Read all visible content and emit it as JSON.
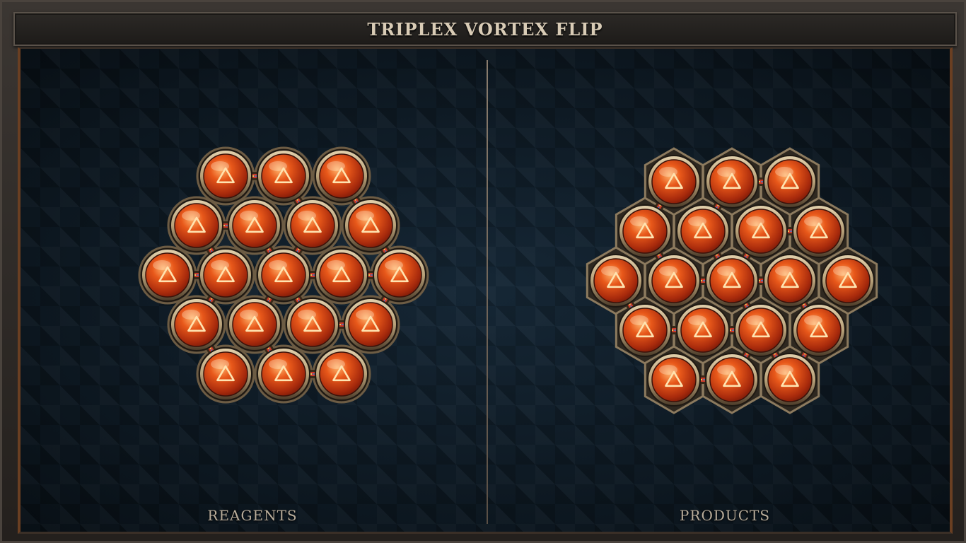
{
  "title": "TRIPLEX VORTEX FLIP",
  "panels": {
    "left_label": "REAGENTS",
    "right_label": "PRODUCTS"
  },
  "atom_symbol": "triangle-icon",
  "colors": {
    "orb": "#e8581a",
    "orb_dark": "#7a1a08",
    "bezel": "#b8a27a",
    "board": "#0f1c27",
    "bond": "#c93a2a"
  },
  "reagents": {
    "atoms": [
      [
        0,
        0
      ],
      [
        1,
        0
      ],
      [
        2,
        0
      ],
      [
        -1,
        1
      ],
      [
        0,
        1
      ],
      [
        1,
        1
      ],
      [
        2,
        1
      ],
      [
        -2,
        2
      ],
      [
        -1,
        2
      ],
      [
        0,
        2
      ],
      [
        1,
        2
      ],
      [
        2,
        2
      ],
      [
        -2,
        3
      ],
      [
        -1,
        3
      ],
      [
        0,
        3
      ],
      [
        1,
        3
      ],
      [
        -2,
        4
      ],
      [
        -1,
        4
      ],
      [
        0,
        4
      ]
    ],
    "bonds": [
      [
        0,
        1
      ],
      [
        1,
        5
      ],
      [
        2,
        6
      ],
      [
        3,
        4
      ],
      [
        3,
        8
      ],
      [
        5,
        9
      ],
      [
        6,
        11
      ],
      [
        7,
        8
      ],
      [
        8,
        12
      ],
      [
        9,
        10
      ],
      [
        9,
        13
      ],
      [
        9,
        14
      ],
      [
        10,
        11
      ],
      [
        11,
        15
      ],
      [
        12,
        16
      ],
      [
        13,
        17
      ],
      [
        14,
        15
      ],
      [
        17,
        18
      ],
      [
        4,
        9
      ]
    ]
  },
  "products": {
    "atoms": [
      [
        0,
        0
      ],
      [
        1,
        0
      ],
      [
        2,
        0
      ],
      [
        -1,
        1
      ],
      [
        0,
        1
      ],
      [
        1,
        1
      ],
      [
        2,
        1
      ],
      [
        -2,
        2
      ],
      [
        -1,
        2
      ],
      [
        0,
        2
      ],
      [
        1,
        2
      ],
      [
        2,
        2
      ],
      [
        -2,
        3
      ],
      [
        -1,
        3
      ],
      [
        0,
        3
      ],
      [
        1,
        3
      ],
      [
        -2,
        4
      ],
      [
        -1,
        4
      ],
      [
        0,
        4
      ]
    ],
    "bonds": [
      [
        1,
        2
      ],
      [
        0,
        3
      ],
      [
        1,
        4
      ],
      [
        5,
        6
      ],
      [
        3,
        8
      ],
      [
        4,
        9
      ],
      [
        5,
        9
      ],
      [
        7,
        12
      ],
      [
        8,
        9
      ],
      [
        9,
        10
      ],
      [
        9,
        14
      ],
      [
        10,
        15
      ],
      [
        12,
        13
      ],
      [
        13,
        14
      ],
      [
        14,
        17
      ],
      [
        15,
        18
      ],
      [
        16,
        17
      ],
      [
        14,
        18
      ]
    ]
  }
}
